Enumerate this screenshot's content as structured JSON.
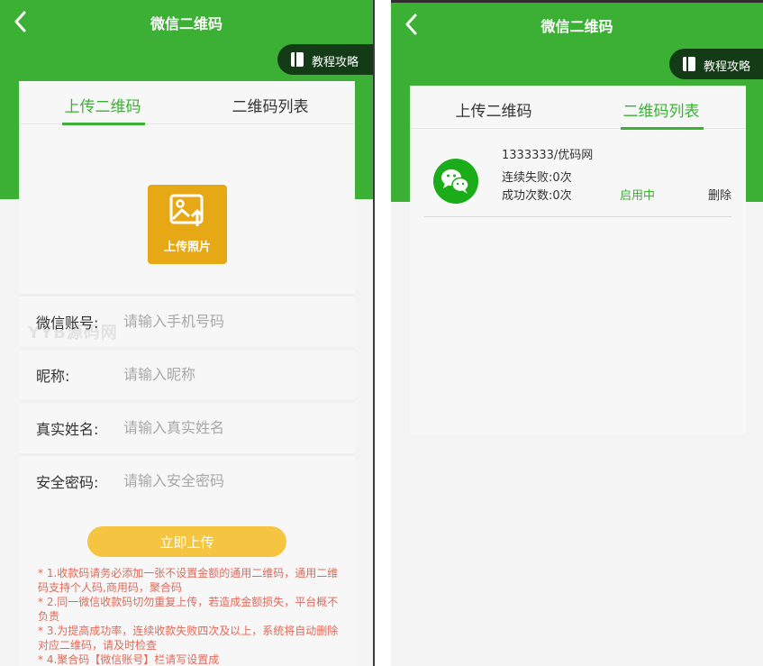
{
  "colors": {
    "brand_green": "#3cb035",
    "guide_dark": "#123b16",
    "upload_tile": "#e6a814",
    "submit_button": "#f5c542",
    "note_text": "#e06a5a",
    "wechat_green": "#1aad19"
  },
  "left_screen": {
    "header": {
      "title": "微信二维码",
      "back_icon": "chevron-left-icon"
    },
    "guide_button": {
      "label": "教程攻略",
      "icon": "book-icon"
    },
    "tabs": [
      {
        "label": "上传二维码",
        "active": true
      },
      {
        "label": "二维码列表",
        "active": false
      }
    ],
    "upload": {
      "label": "上传照片",
      "icon": "image-upload-icon"
    },
    "form": {
      "fields": [
        {
          "label": "微信账号:",
          "placeholder": "请输入手机号码"
        },
        {
          "label": "昵称:",
          "placeholder": "请输入昵称"
        },
        {
          "label": "真实姓名:",
          "placeholder": "请输入真实姓名"
        },
        {
          "label": "安全密码:",
          "placeholder": "请输入安全密码"
        }
      ],
      "watermark": "YYB源码网"
    },
    "submit_label": "立即上传",
    "notes": [
      "* 1.收款码请务必添加一张不设置金额的通用二维码，通用二维码支持个人码,商用码，聚合码",
      "* 2.同一微信收款码切勿重复上传，若造成金额损失，平台概不负责",
      "* 3.为提高成功率，连续收款失败四次及以上，系统将自动删除对应二维码，请及时检查",
      "* 4.聚合码【微信账号】栏请写设置成"
    ]
  },
  "right_screen": {
    "header": {
      "title": "微信二维码",
      "back_icon": "chevron-left-icon"
    },
    "guide_button": {
      "label": "教程攻略",
      "icon": "book-icon"
    },
    "tabs": [
      {
        "label": "上传二维码",
        "active": false
      },
      {
        "label": "二维码列表",
        "active": true
      }
    ],
    "qr_list": [
      {
        "account": "1333333/优码网",
        "fail_text": "连续失败:0次",
        "success_text": "成功次数:0次",
        "status": "启用中",
        "delete_label": "删除",
        "icon": "wechat-icon"
      }
    ]
  }
}
